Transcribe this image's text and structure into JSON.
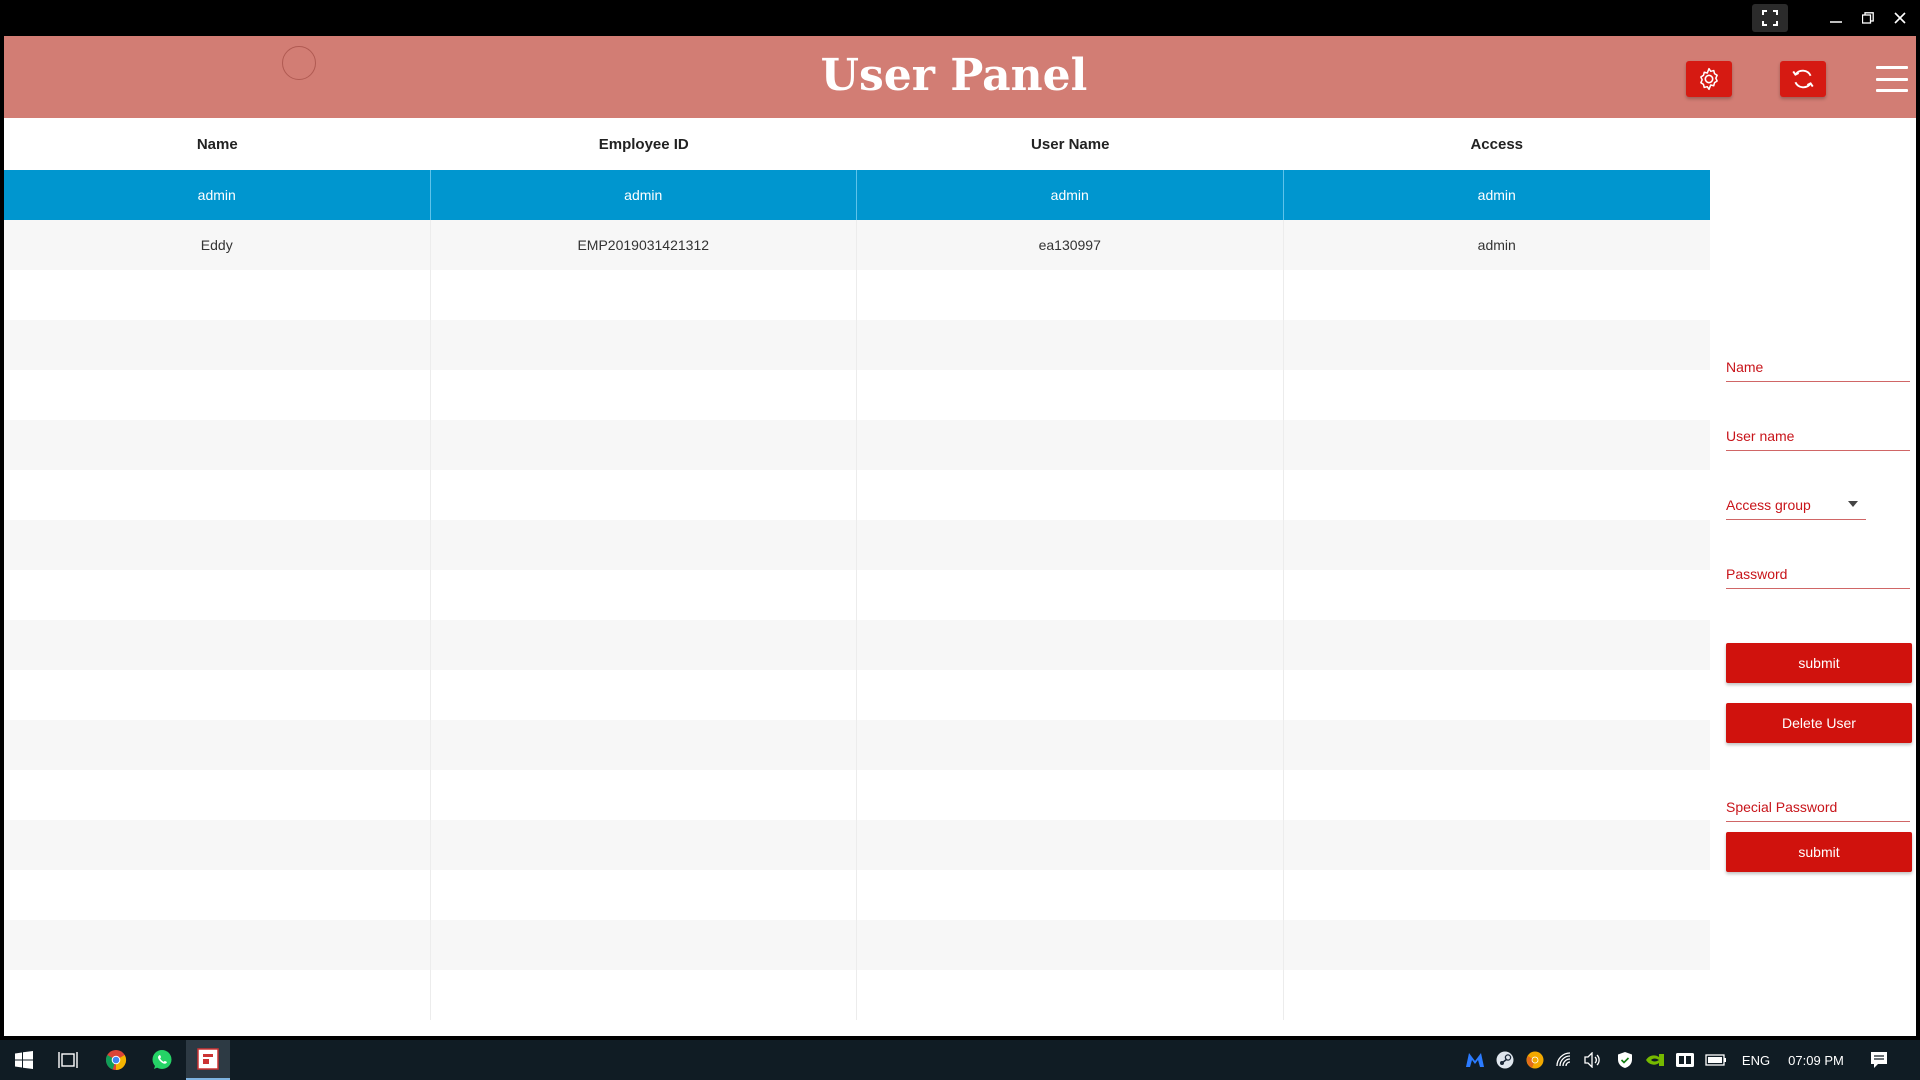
{
  "app": {
    "title": "User Panel"
  },
  "table": {
    "columns": [
      "Name",
      "Employee ID",
      "User Name",
      "Access"
    ],
    "rows": [
      [
        "admin",
        "admin",
        "admin",
        "admin"
      ],
      [
        "Eddy",
        "EMP2019031421312",
        "ea130997",
        "admin"
      ]
    ],
    "selected_row": 0
  },
  "form": {
    "name_label": "Name",
    "username_label": "User name",
    "access_group_label": "Access group",
    "password_label": "Password",
    "submit_label": "submit",
    "delete_label": "Delete User",
    "special_password_label": "Special Password",
    "special_submit_label": "submit"
  },
  "taskbar": {
    "language": "ENG",
    "time": "07:09 PM"
  },
  "colors": {
    "header": "#d27d74",
    "accent_red": "#d0120d",
    "selected_row": "#0096cf",
    "taskbar": "#101c24"
  }
}
